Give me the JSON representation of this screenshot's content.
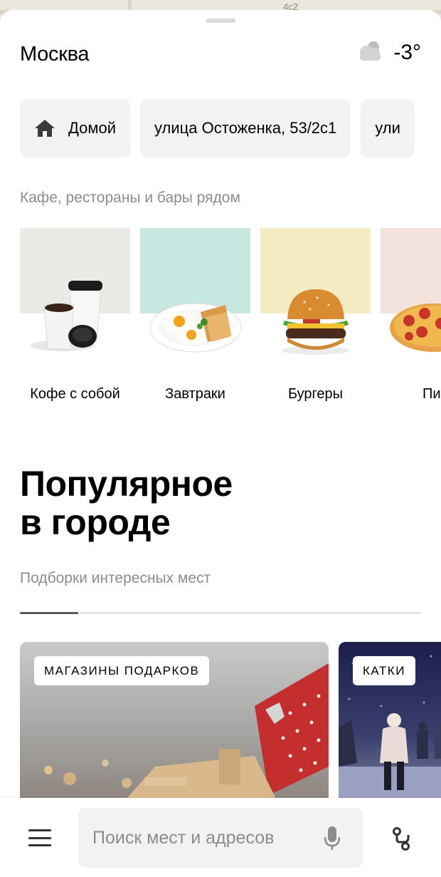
{
  "map": {
    "label": "4с2"
  },
  "header": {
    "city": "Москва",
    "weather_icon": "cloud-icon",
    "temperature": "-3°"
  },
  "chips": [
    {
      "label": "Домой",
      "icon": "home-icon"
    },
    {
      "label": "улица Остоженка, 53/2с1"
    },
    {
      "label": "ули"
    }
  ],
  "nearby": {
    "title": "Кафе, рестораны и бары рядом",
    "categories": [
      {
        "label": "Кофе с собой",
        "color": "#ebebe6"
      },
      {
        "label": "Завтраки",
        "color": "#c7e7e1"
      },
      {
        "label": "Бургеры",
        "color": "#f6ecc4"
      },
      {
        "label": "Пиц",
        "color": "#f4e3dd"
      }
    ]
  },
  "popular": {
    "title_line1": "Популярное",
    "title_line2": "в городе",
    "subtitle": "Подборки интересных мест",
    "progress_fraction": 0.145,
    "cards": [
      {
        "tag": "МАГАЗИНЫ ПОДАРКОВ"
      },
      {
        "tag": "КАТКИ"
      }
    ]
  },
  "bottom_bar": {
    "search_placeholder": "Поиск мест и адресов",
    "menu_icon": "menu-icon",
    "mic_icon": "mic-icon",
    "route_icon": "route-icon"
  }
}
